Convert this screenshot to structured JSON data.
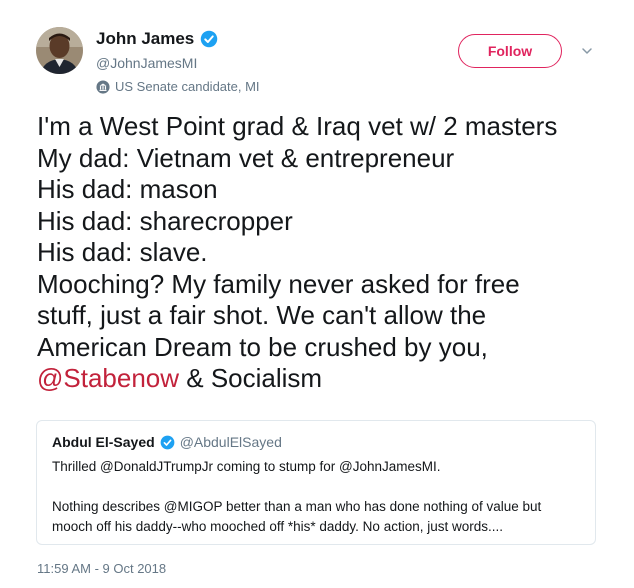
{
  "author": {
    "name": "John James",
    "handle": "@JohnJamesMI",
    "label": "US Senate candidate, MI"
  },
  "follow_label": "Follow",
  "tweet": {
    "lines": [
      "I'm a West Point grad & Iraq vet w/ 2 masters",
      "My dad: Vietnam vet & entrepreneur",
      "His dad: mason",
      "His dad: sharecropper",
      "His dad: slave.",
      "Mooching? My family never asked for free",
      "stuff, just a fair shot. We can't allow the",
      "American Dream to be crushed by you,"
    ],
    "last_line_mention": "@Stabenow",
    "last_line_rest": " & Socialism"
  },
  "quoted": {
    "name": "Abdul El-Sayed",
    "handle": "@AbdulElSayed",
    "para1": "Thrilled @DonaldJTrumpJr coming to stump for @JohnJamesMI.",
    "para2_line1": "Nothing describes @MIGOP better than a man who has done nothing of value but",
    "para2_line2": "mooch off his daddy--who mooched off *his* daddy. No action, just words...."
  },
  "timestamp": "11:59 AM - 9 Oct 2018",
  "colors": {
    "accent": "#e0245e",
    "mention": "#c2223b",
    "verified": "#1da1f2",
    "secondary_text": "#657786"
  },
  "icons": {
    "verified": "verified-badge-icon",
    "label": "government-building-icon",
    "caret": "chevron-down-icon"
  }
}
